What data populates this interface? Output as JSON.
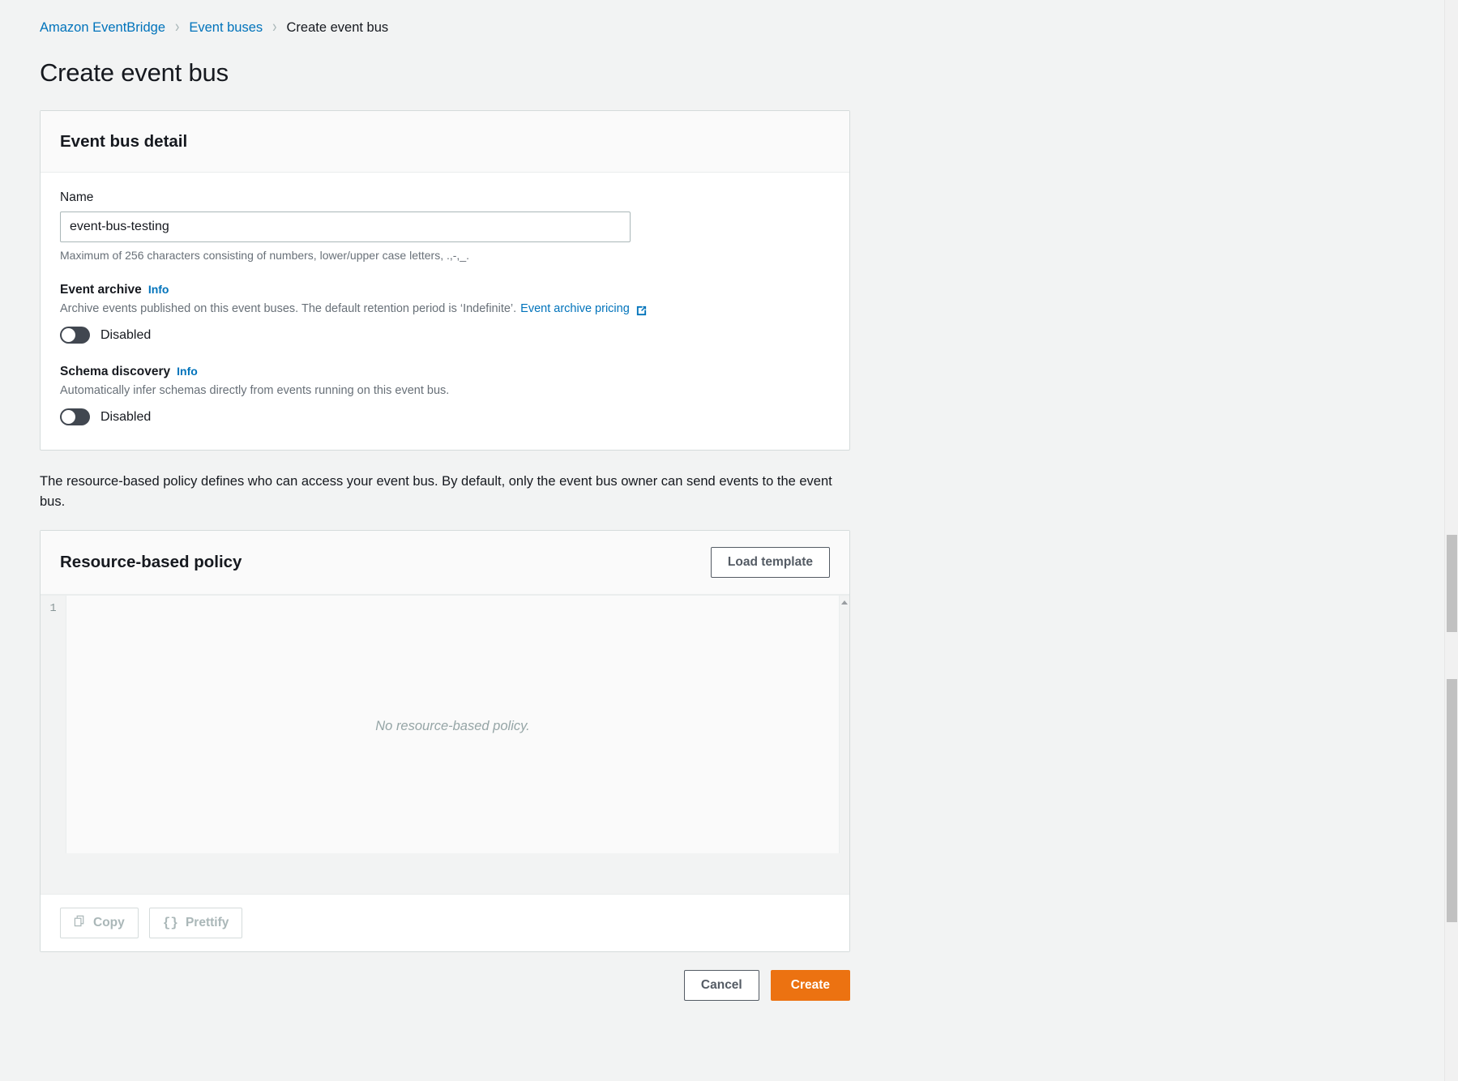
{
  "breadcrumb": {
    "items": [
      {
        "label": "Amazon EventBridge",
        "type": "link"
      },
      {
        "label": "Event buses",
        "type": "link"
      },
      {
        "label": "Create event bus",
        "type": "current"
      }
    ],
    "separator": "›"
  },
  "page": {
    "title": "Create event bus"
  },
  "event_bus_detail": {
    "card_title": "Event bus detail",
    "name": {
      "label": "Name",
      "value": "event-bus-testing",
      "placeholder": "",
      "help": "Maximum of 256 characters consisting of numbers, lower/upper case letters, .,-,_."
    },
    "event_archive": {
      "label": "Event archive",
      "info_label": "Info",
      "description": "Archive events published on this event buses. The default retention period is ‘Indefinite’.",
      "link_label": "Event archive pricing",
      "link_icon": "external-link-icon",
      "toggle_state": "Disabled"
    },
    "schema_discovery": {
      "label": "Schema discovery",
      "info_label": "Info",
      "description": "Automatically infer schemas directly from events running on this event bus.",
      "toggle_state": "Disabled"
    }
  },
  "policy_note": "The resource-based policy defines who can access your event bus. By default, only the event bus owner can send events to the event bus.",
  "resource_policy": {
    "card_title": "Resource-based policy",
    "load_template_label": "Load template",
    "editor": {
      "line_numbers": [
        "1"
      ],
      "placeholder": "No resource-based policy.",
      "value": "",
      "scroll_arrow_icon": "scroll-up-arrow-icon"
    },
    "toolbar": {
      "copy_label": "Copy",
      "copy_icon": "copy-icon",
      "prettify_label": "Prettify",
      "prettify_icon": "braces-icon"
    }
  },
  "footer": {
    "cancel_label": "Cancel",
    "create_label": "Create"
  },
  "colors": {
    "accent_link": "#0073bb",
    "primary_button": "#ec7211",
    "page_background": "#f2f3f3",
    "toggle_off": "#414750"
  }
}
